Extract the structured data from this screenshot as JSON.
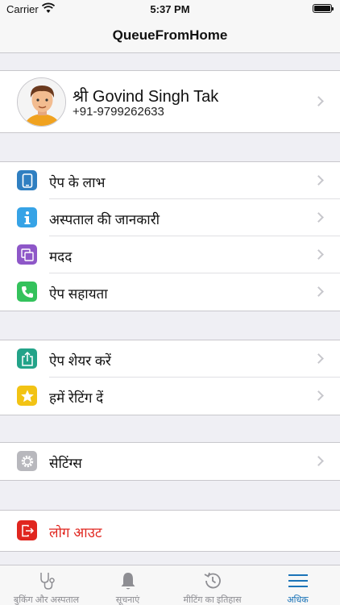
{
  "status_bar": {
    "carrier": "Carrier",
    "time": "5:37 PM"
  },
  "nav": {
    "title": "QueueFromHome"
  },
  "profile": {
    "name": "श्री  Govind Singh Tak",
    "phone": "+91-9799262633"
  },
  "menu_group_1": [
    {
      "label": "ऐप के लाभ",
      "icon": "phone-icon",
      "color": "#2f7fc1"
    },
    {
      "label": "अस्पताल की जानकारी",
      "icon": "info-icon",
      "color": "#36a3e6"
    },
    {
      "label": "मदद",
      "icon": "copy-icon",
      "color": "#8e57c8"
    },
    {
      "label": "ऐप सहायता",
      "icon": "call-icon",
      "color": "#34c25c"
    }
  ],
  "menu_group_2": [
    {
      "label": "ऐप शेयर करें",
      "icon": "share-icon",
      "color": "#23a389"
    },
    {
      "label": "हमें रेटिंग दें",
      "icon": "star-icon",
      "color": "#f2c314"
    }
  ],
  "menu_group_3": [
    {
      "label": "सेटिंग्स",
      "icon": "gear-icon",
      "color": "#b8b8bd"
    }
  ],
  "logout": {
    "label": "लोग आउट",
    "icon": "logout-icon",
    "color": "#e0261f"
  },
  "tabs": [
    {
      "label": "बुकिंग और अस्पताल",
      "icon": "stethoscope-icon",
      "active": false
    },
    {
      "label": "सूचनाएं",
      "icon": "bell-icon",
      "active": false
    },
    {
      "label": "मीटिंग का इतिहास",
      "icon": "history-icon",
      "active": false
    },
    {
      "label": "अधिक",
      "icon": "menu-icon",
      "active": true
    }
  ],
  "colors": {
    "accent": "#1b74b8",
    "logout": "#e0261f",
    "background": "#efeff4"
  }
}
